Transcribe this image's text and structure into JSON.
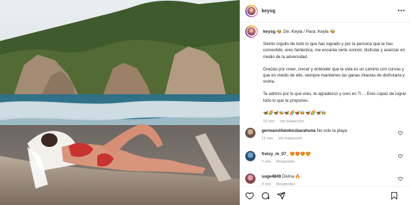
{
  "post": {
    "username": "keysg",
    "caption_user": "keysg",
    "caption_intro": "🐝 De: Keyla / Para: Keyla 🐝",
    "paragraphs": [
      "Siento orgullo de todo lo que has logrado y por la persona que te has convertido, eres fantástica, me encanta verte sonreír, disfrutar y avanzar en medio de la adversidad.",
      "Gracias por creer, crecer y entender que la vida es un camino con curvas y que en medio de ello, siempre mantienes las ganas intactas de disfrutarla y vivirla.",
      "Te admiro por lo que eres, te agradezco y creo en Ti ... Eres capaz de lograr todo lo que te propones.",
      "🦋🌈🦋🐝🦋🌈🦋🐝🦋🌈🦋🐝"
    ],
    "time": "15 min",
    "translate": "Ver traducción"
  },
  "comments": [
    {
      "user": "germanvillalobosbarahona",
      "text": "No solo la playa",
      "time": "11 min",
      "action": "Ver traducción"
    },
    {
      "user": "freisy_m_07_",
      "text": "😍😍😍😍",
      "time": "7 min",
      "action": "Responder"
    },
    {
      "user": "suge4849",
      "text": "Divina 🔥",
      "time": "4 min",
      "action": "Responder"
    }
  ],
  "icons": {
    "more": "more-options-icon",
    "like": "heart-icon",
    "comment": "comment-icon",
    "share": "share-icon",
    "save": "bookmark-icon"
  },
  "colors": {
    "text": "#262626",
    "muted": "#8e8e8e",
    "divider": "#efefef"
  }
}
